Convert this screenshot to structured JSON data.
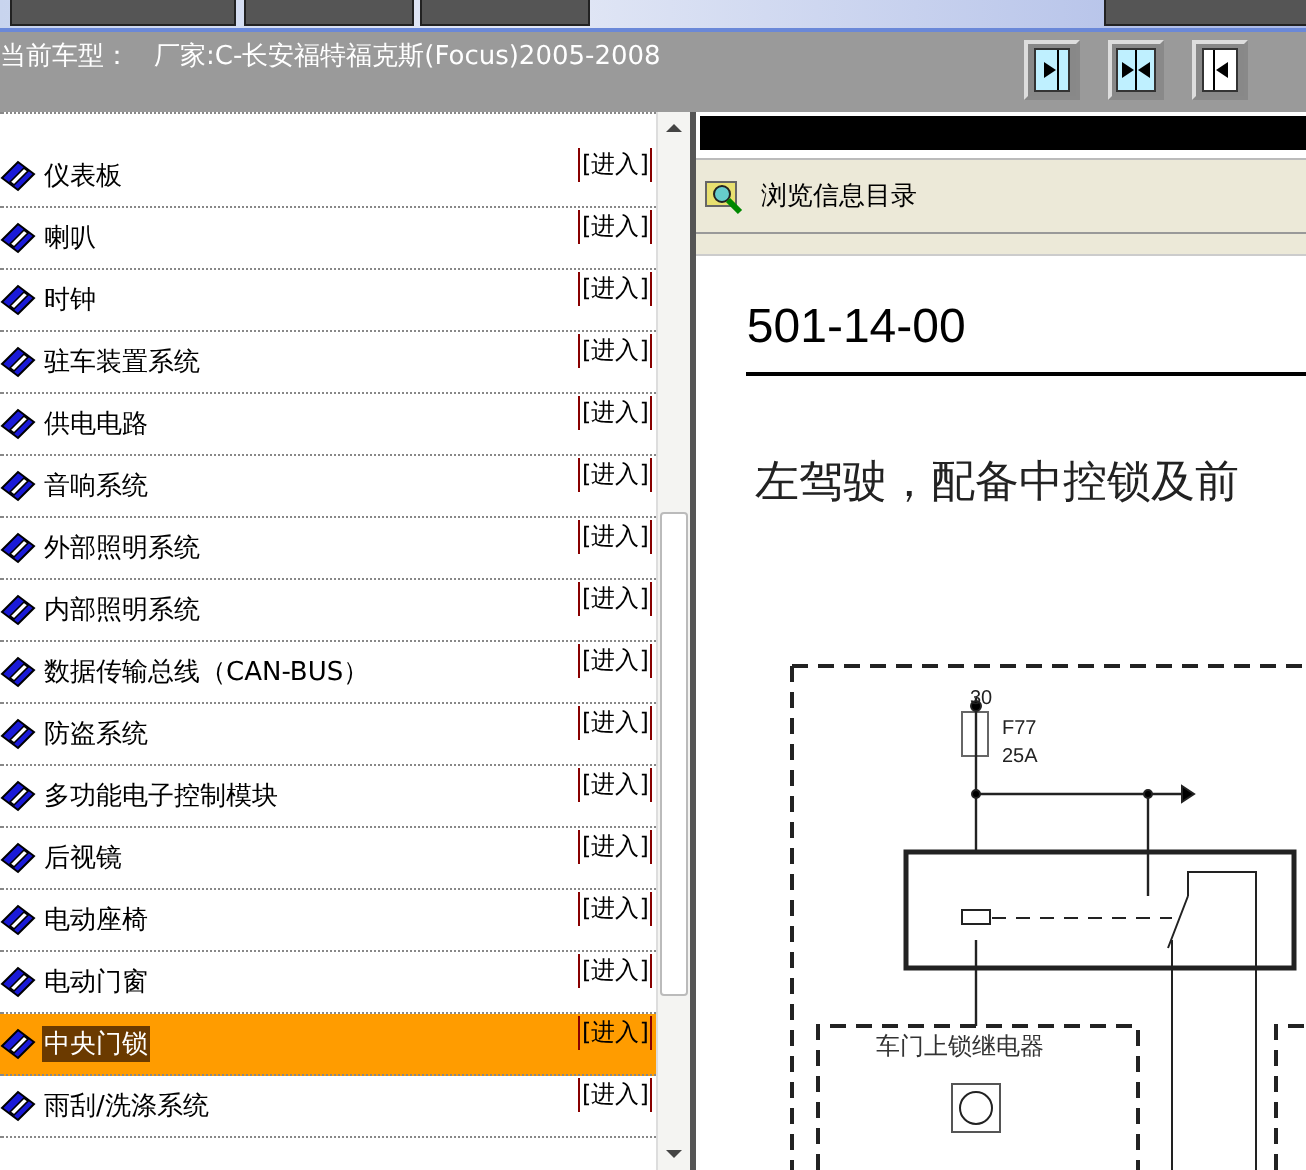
{
  "header": {
    "model_label": "当前车型：",
    "model_value": "厂家:C-长安福特福克斯(Focus)2005-2008"
  },
  "systems": [
    {
      "name": "仪表板",
      "link": "[进入]",
      "selected": false
    },
    {
      "name": "喇叭",
      "link": "[进入]",
      "selected": false
    },
    {
      "name": "时钟",
      "link": "[进入]",
      "selected": false
    },
    {
      "name": "驻车装置系统",
      "link": "[进入]",
      "selected": false
    },
    {
      "name": "供电电路",
      "link": "[进入]",
      "selected": false
    },
    {
      "name": "音响系统",
      "link": "[进入]",
      "selected": false
    },
    {
      "name": "外部照明系统",
      "link": "[进入]",
      "selected": false
    },
    {
      "name": "内部照明系统",
      "link": "[进入]",
      "selected": false
    },
    {
      "name": "数据传输总线（CAN-BUS）",
      "link": "[进入]",
      "selected": false
    },
    {
      "name": "防盗系统",
      "link": "[进入]",
      "selected": false
    },
    {
      "name": "多功能电子控制模块",
      "link": "[进入]",
      "selected": false
    },
    {
      "name": "后视镜",
      "link": "[进入]",
      "selected": false
    },
    {
      "name": "电动座椅",
      "link": "[进入]",
      "selected": false
    },
    {
      "name": "电动门窗",
      "link": "[进入]",
      "selected": false
    },
    {
      "name": "中央门锁",
      "link": "[进入]",
      "selected": true
    },
    {
      "name": "雨刮/洗涤系统",
      "link": "[进入]",
      "selected": false
    }
  ],
  "viewer": {
    "toolbar_label": "浏览信息目录",
    "doc_code": "501-14-00",
    "doc_title": "左驾驶，配备中控锁及前",
    "diagram": {
      "terminal": "30",
      "fuse_name": "F77",
      "fuse_rating": "25A",
      "relay_label": "车门上锁继电器"
    }
  }
}
